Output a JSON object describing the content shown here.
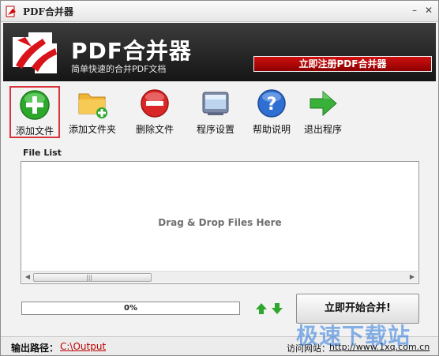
{
  "window": {
    "title": "PDF合并器"
  },
  "header": {
    "title": "PDF合并器",
    "subtitle": "简单快速的合并PDF文档",
    "register_label": "立即注册PDF合并器"
  },
  "toolbar": {
    "items": [
      {
        "label": "添加文件",
        "icon": "add-icon"
      },
      {
        "label": "添加文件夹",
        "icon": "add-folder-icon"
      },
      {
        "label": "删除文件",
        "icon": "delete-icon"
      },
      {
        "label": "程序设置",
        "icon": "settings-icon"
      },
      {
        "label": "帮助说明",
        "icon": "help-icon"
      },
      {
        "label": "退出程序",
        "icon": "exit-icon"
      }
    ],
    "selected_index": 0
  },
  "file_list": {
    "label": "File List",
    "placeholder": "Drag & Drop Files Here",
    "scroll_grip": "|||"
  },
  "progress": {
    "value": 0,
    "text": "0%"
  },
  "actions": {
    "start_label": "立即开始合并!"
  },
  "status": {
    "output_label": "输出路径：",
    "output_path": "C:\\Output",
    "site_label": "访问网站：",
    "site_url": "http://www.1xq.com.cn"
  },
  "watermark": {
    "text": "极速下载站"
  },
  "colors": {
    "accent_red": "#d01010",
    "header_dark": "#1e1e1e",
    "progress_green": "#3bb53b",
    "link_red": "#c00000"
  }
}
